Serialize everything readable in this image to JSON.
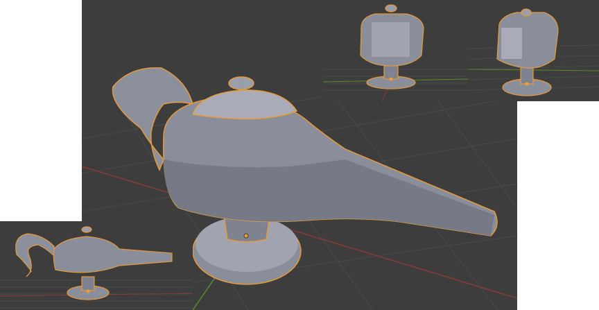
{
  "scene": {
    "object": "lamp-mesh-icon",
    "viewports": [
      {
        "id": "main",
        "view": "perspective-side"
      },
      {
        "id": "top1",
        "view": "front"
      },
      {
        "id": "top2",
        "view": "three-quarter"
      },
      {
        "id": "small",
        "view": "side"
      }
    ]
  },
  "colors": {
    "viewport_bg": "#3d3d3d",
    "grid": "#4a4a4a",
    "axis_x": "#8a3a3a",
    "axis_y": "#5a8a2a",
    "mesh": "#8a8d9a",
    "mesh_light": "#a9acb8",
    "mesh_dark": "#6a6d78",
    "outline": "#e79a3a",
    "origin": "#f0a030"
  }
}
